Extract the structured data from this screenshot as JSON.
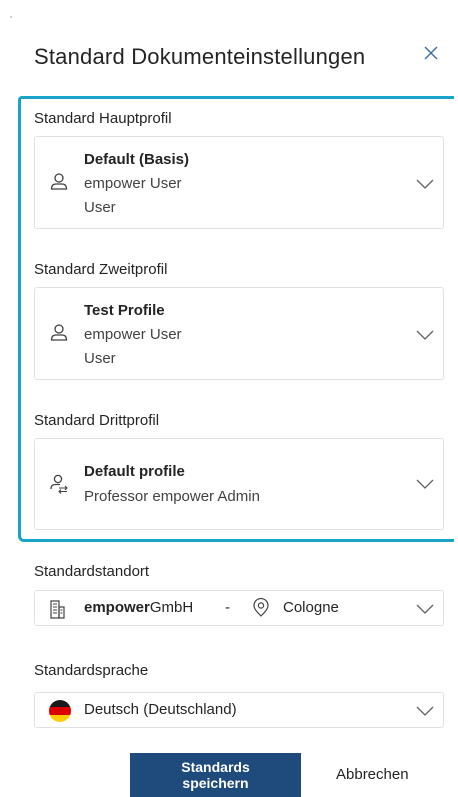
{
  "dialog": {
    "title": "Standard Dokumenteinstellungen"
  },
  "profiles": {
    "primary": {
      "label": "Standard Hauptprofil",
      "name": "Default (Basis)",
      "line1": "empower User",
      "line2": "User"
    },
    "secondary": {
      "label": "Standard Zweitprofil",
      "name": "Test Profile",
      "line1": "empower User",
      "line2": "User"
    },
    "tertiary": {
      "label": "Standard Drittprofil",
      "name": "Default profile",
      "line1": "Professor empower Admin"
    }
  },
  "location": {
    "label": "Standardstandort",
    "company_bold": "empower",
    "company_rest": "GmbH",
    "separator": "-",
    "city": "Cologne"
  },
  "language": {
    "label": "Standardsprache",
    "value": "Deutsch (Deutschland)"
  },
  "buttons": {
    "save_line1": "Standards",
    "save_line2": "speichern",
    "cancel": "Abbrechen"
  },
  "colors": {
    "highlight": "#1aa3c8",
    "primary_button": "#1f4a7c"
  },
  "icons": {
    "close": "close-icon",
    "person": "person-icon",
    "person_swap": "person-swap-icon",
    "building": "building-icon",
    "location": "location-pin-icon",
    "flag": "germany-flag-icon",
    "chevron": "chevron-down-icon"
  }
}
